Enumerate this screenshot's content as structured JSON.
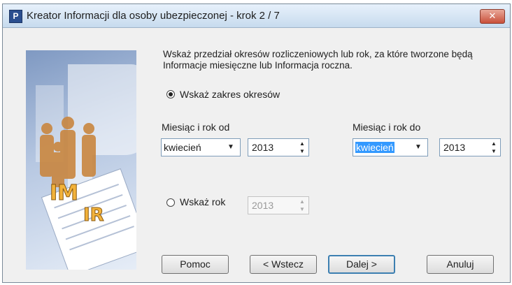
{
  "window": {
    "title": "Kreator Informacji dla osoby ubezpieczonej  - krok 2 / 7",
    "icon_letter": "P",
    "close_glyph": "✕"
  },
  "description": "Wskaż przedział okresów rozliczeniowych lub rok, za które tworzone będą Informacje miesięczne lub Informacja roczna.",
  "banner": {
    "text_im": "IM",
    "text_ir": "IR"
  },
  "option_range": {
    "label": "Wskaż zakres okresów",
    "selected": true
  },
  "from": {
    "label": "Miesiąc i rok od",
    "month": "kwiecień",
    "year": "2013"
  },
  "to": {
    "label": "Miesiąc i rok do",
    "month": "kwiecień",
    "year": "2013"
  },
  "option_year": {
    "label": "Wskaż rok",
    "selected": false,
    "year": "2013"
  },
  "buttons": {
    "help": "Pomoc",
    "back": "< Wstecz",
    "next": "Dalej >",
    "cancel": "Anuluj"
  },
  "glyphs": {
    "dropdown": "▼",
    "up": "▲",
    "down": "▼"
  }
}
